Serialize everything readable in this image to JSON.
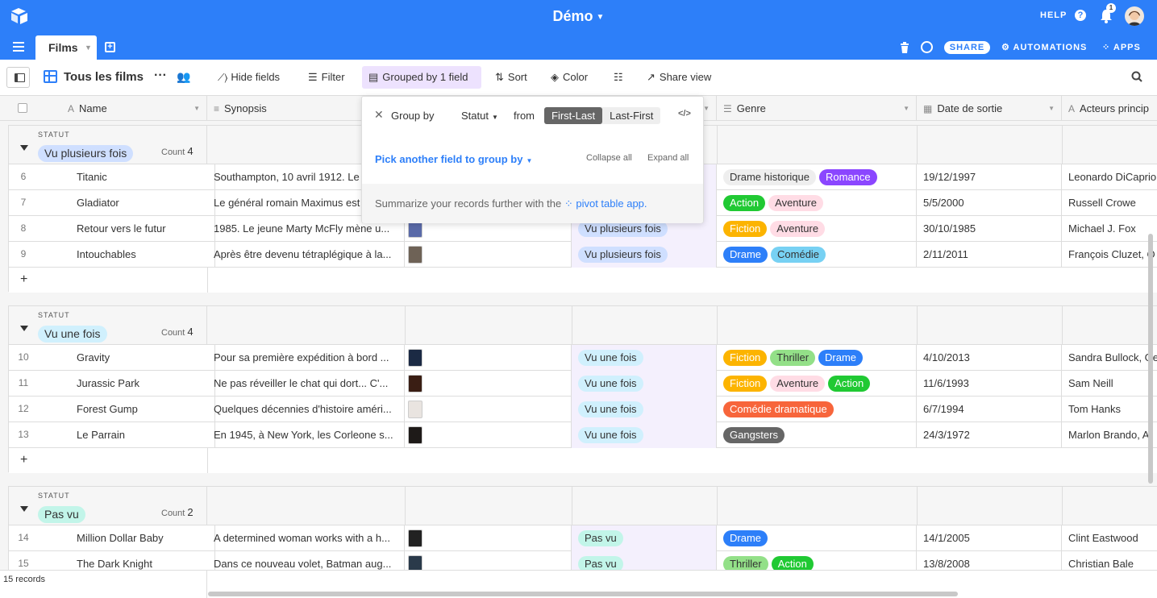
{
  "app": {
    "title": "Démo",
    "help_label": "HELP",
    "notif_count": "1"
  },
  "tabs": {
    "active_label": "Films"
  },
  "header_actions": {
    "share_label": "SHARE",
    "automations_label": "AUTOMATIONS",
    "apps_label": "APPS"
  },
  "toolbar": {
    "view_name": "Tous les films",
    "hide_fields": "Hide fields",
    "filter": "Filter",
    "grouped": "Grouped by 1 field",
    "sort": "Sort",
    "color": "Color",
    "share_view": "Share view"
  },
  "columns": [
    "Name",
    "Synopsis",
    "",
    "",
    "Genre",
    "Date de sortie",
    "Acteurs princip"
  ],
  "groups": [
    {
      "label_header": "STATUT",
      "name": "Vu plusieurs fois",
      "count_label": "Count",
      "count": "4",
      "pill_color": "#cfdfff",
      "rows": [
        {
          "num": "6",
          "name": "Titanic",
          "synopsis": "Southampton, 10 avril 1912. Le",
          "statut": "",
          "genres": [
            {
              "t": "Drame historique",
              "bg": "#eeeeee",
              "fg": "#333333"
            },
            {
              "t": "Romance",
              "bg": "#8b46ff",
              "fg": "#ffffff"
            }
          ],
          "date": "19/12/1997",
          "acteurs": "Leonardo DiCaprio",
          "thumb": ""
        },
        {
          "num": "7",
          "name": "Gladiator",
          "synopsis": "Le général romain Maximus est",
          "statut": "",
          "genres": [
            {
              "t": "Action",
              "bg": "#20c933",
              "fg": "#ffffff"
            },
            {
              "t": "Aventure",
              "bg": "#ffdce5",
              "fg": "#333333"
            }
          ],
          "date": "5/5/2000",
          "acteurs": "Russell Crowe",
          "thumb": ""
        },
        {
          "num": "8",
          "name": "Retour vers le futur",
          "synopsis": "1985. Le jeune Marty McFly mène u...",
          "statut": "Vu plusieurs fois",
          "genres": [
            {
              "t": "Fiction",
              "bg": "#fcb400",
              "fg": "#ffffff"
            },
            {
              "t": "Aventure",
              "bg": "#ffdce5",
              "fg": "#333333"
            }
          ],
          "date": "30/10/1985",
          "acteurs": "Michael J. Fox",
          "thumb": "#5a6aa8"
        },
        {
          "num": "9",
          "name": "Intouchables",
          "synopsis": "Après être devenu tétraplégique à la...",
          "statut": "Vu plusieurs fois",
          "genres": [
            {
              "t": "Drame",
              "bg": "#2d7ff9",
              "fg": "#ffffff"
            },
            {
              "t": "Comédie",
              "bg": "#77d1f3",
              "fg": "#333333"
            }
          ],
          "date": "2/11/2011",
          "acteurs": "François Cluzet, O",
          "thumb": "#6e6256"
        }
      ]
    },
    {
      "label_header": "STATUT",
      "name": "Vu une fois",
      "count_label": "Count",
      "count": "4",
      "pill_color": "#d0f0fd",
      "rows": [
        {
          "num": "10",
          "name": "Gravity",
          "synopsis": "Pour sa première expédition à bord ...",
          "statut": "Vu une fois",
          "genres": [
            {
              "t": "Fiction",
              "bg": "#fcb400",
              "fg": "#ffffff"
            },
            {
              "t": "Thriller",
              "bg": "#93e088",
              "fg": "#333333"
            },
            {
              "t": "Drame",
              "bg": "#2d7ff9",
              "fg": "#ffffff"
            }
          ],
          "date": "4/10/2013",
          "acteurs": "Sandra Bullock, Ge",
          "thumb": "#1b2a44"
        },
        {
          "num": "11",
          "name": "Jurassic Park",
          "synopsis": "Ne pas réveiller le chat qui dort... C'...",
          "statut": "Vu une fois",
          "genres": [
            {
              "t": "Fiction",
              "bg": "#fcb400",
              "fg": "#ffffff"
            },
            {
              "t": "Aventure",
              "bg": "#ffdce5",
              "fg": "#333333"
            },
            {
              "t": "Action",
              "bg": "#20c933",
              "fg": "#ffffff"
            }
          ],
          "date": "11/6/1993",
          "acteurs": "Sam Neill",
          "thumb": "#3a1e14"
        },
        {
          "num": "12",
          "name": "Forest Gump",
          "synopsis": "Quelques décennies d'histoire améri...",
          "statut": "Vu une fois",
          "genres": [
            {
              "t": "Comédie dramatique",
              "bg": "#f7653b",
              "fg": "#ffffff"
            }
          ],
          "date": "6/7/1994",
          "acteurs": "Tom Hanks",
          "thumb": "#e9e4e0"
        },
        {
          "num": "13",
          "name": "Le Parrain",
          "synopsis": "En 1945, à New York, les Corleone s...",
          "statut": "Vu une fois",
          "genres": [
            {
              "t": "Gangsters",
              "bg": "#666666",
              "fg": "#ffffff"
            }
          ],
          "date": "24/3/1972",
          "acteurs": "Marlon Brando, Al",
          "thumb": "#1e1a18"
        }
      ]
    },
    {
      "label_header": "STATUT",
      "name": "Pas vu",
      "count_label": "Count",
      "count": "2",
      "pill_color": "#c2f5e9",
      "rows": [
        {
          "num": "14",
          "name": "Million Dollar Baby",
          "synopsis": "A determined woman works with a h...",
          "statut": "Pas vu",
          "genres": [
            {
              "t": "Drame",
              "bg": "#2d7ff9",
              "fg": "#ffffff"
            }
          ],
          "date": "14/1/2005",
          "acteurs": "Clint Eastwood",
          "thumb": "#222"
        },
        {
          "num": "15",
          "name": "The Dark Knight",
          "synopsis": "Dans ce nouveau volet, Batman aug...",
          "statut": "Pas vu",
          "genres": [
            {
              "t": "Thriller",
              "bg": "#93e088",
              "fg": "#333333"
            },
            {
              "t": "Action",
              "bg": "#20c933",
              "fg": "#ffffff"
            }
          ],
          "date": "13/8/2008",
          "acteurs": "Christian Bale",
          "thumb": "#2a3a4a"
        }
      ]
    }
  ],
  "footer": {
    "records": "15 records"
  },
  "popup": {
    "group_by": "Group by",
    "field": "Statut",
    "from": "from",
    "first_last": "First-Last",
    "last_first": "Last-First",
    "pick": "Pick another field to group by",
    "collapse_all": "Collapse all",
    "expand_all": "Expand all",
    "summ_text": "Summarize your records further with the",
    "summ_link": "pivot table app."
  },
  "colors": {
    "brand": "#2d7ff9",
    "grouped_bg": "#ede2fe",
    "statut_col_bg": "#f4f0fd"
  }
}
